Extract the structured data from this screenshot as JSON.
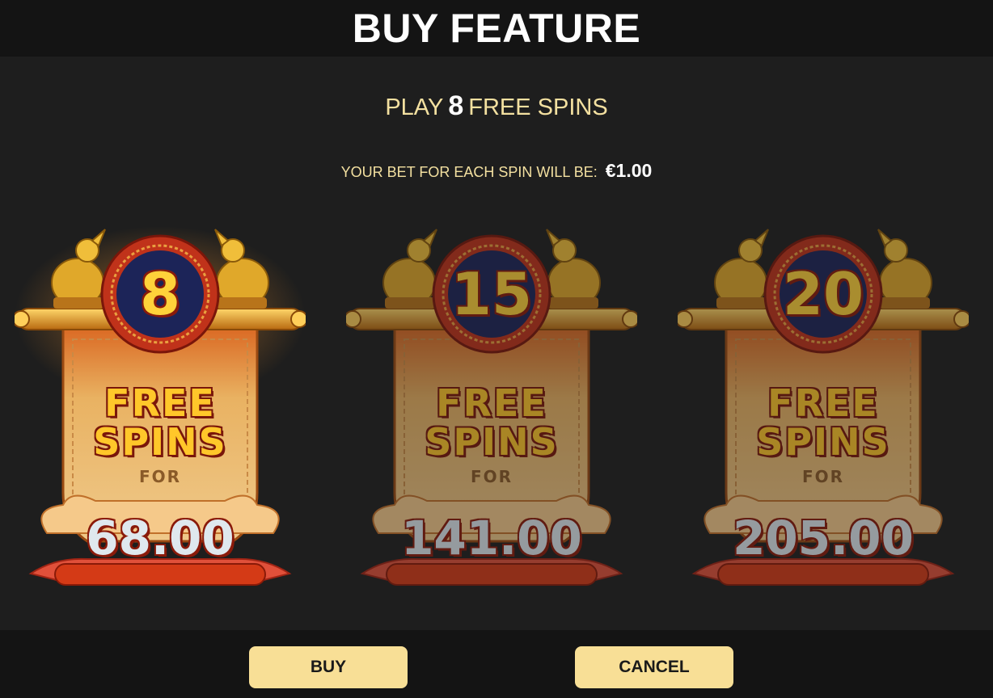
{
  "header": {
    "title": "BUY FEATURE"
  },
  "subtitle": {
    "prefix": "PLAY",
    "spins": "8",
    "suffix": "FREE SPINS"
  },
  "bet": {
    "label": "YOUR BET FOR EACH SPIN WILL BE:",
    "amount": "€1.00"
  },
  "options": [
    {
      "spins": "8",
      "free": "FREE",
      "spins_word": "SPINS",
      "for": "FOR",
      "price": "68.00",
      "selected": true
    },
    {
      "spins": "15",
      "free": "FREE",
      "spins_word": "SPINS",
      "for": "FOR",
      "price": "141.00",
      "selected": false
    },
    {
      "spins": "20",
      "free": "FREE",
      "spins_word": "SPINS",
      "for": "FOR",
      "price": "205.00",
      "selected": false
    }
  ],
  "buttons": {
    "buy": "BUY",
    "cancel": "CANCEL"
  },
  "colors": {
    "accent": "#f3e0a0",
    "button": "#f8df96",
    "background": "#1e1e1e",
    "header": "#141414"
  },
  "icons": {
    "ornament": "rabbit-statue-icon",
    "medallion": "coin-medallion-icon"
  }
}
